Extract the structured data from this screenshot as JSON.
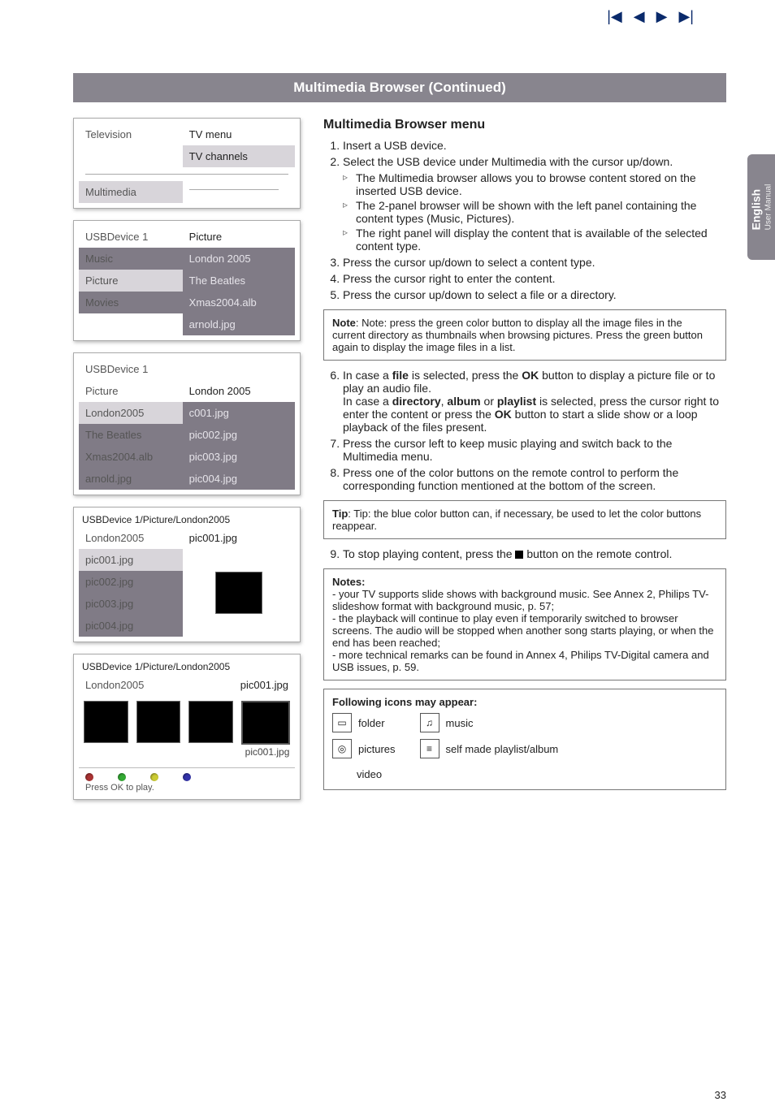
{
  "nav": {
    "first": "|◀",
    "prev": "◀",
    "next": "▶",
    "last": "▶|"
  },
  "titlebar": "Multimedia Browser  (Continued)",
  "side_tab": {
    "line1": "English",
    "line2": "User Manual"
  },
  "left": {
    "panel1": {
      "rows": [
        {
          "l": "Television",
          "r1": "TV menu",
          "r2": "TV channels"
        },
        {
          "l": "Multimedia",
          "r1": "",
          "r2": ""
        }
      ]
    },
    "panel2": {
      "rows": [
        {
          "l": "USBDevice 1",
          "r": "Picture"
        },
        {
          "l": "Music",
          "r": "London 2005"
        },
        {
          "l": "Picture",
          "r": "The Beatles"
        },
        {
          "l": "Movies",
          "r": "Xmas2004.alb"
        },
        {
          "l": "",
          "r": "arnold.jpg"
        }
      ]
    },
    "panel3": {
      "rows": [
        {
          "l": "USBDevice 1",
          "r": ""
        },
        {
          "l": "Picture",
          "r": "London 2005"
        },
        {
          "l": "London2005",
          "r": "c001.jpg"
        },
        {
          "l": "The Beatles",
          "r": "pic002.jpg"
        },
        {
          "l": "Xmas2004.alb",
          "r": "pic003.jpg"
        },
        {
          "l": "arnold.jpg",
          "r": "pic004.jpg"
        }
      ]
    },
    "panel4": {
      "title": "USBDevice 1/Picture/London2005",
      "rows": [
        {
          "l": "London2005",
          "r": "pic001.jpg"
        },
        {
          "l": "pic001.jpg",
          "r": ""
        },
        {
          "l": "pic002.jpg",
          "r": ""
        },
        {
          "l": "pic003.jpg",
          "r": ""
        },
        {
          "l": "pic004.jpg",
          "r": ""
        }
      ]
    },
    "panel5": {
      "title": "USBDevice 1/Picture/London2005",
      "headerL": "London2005",
      "headerR": "pic001.jpg",
      "thumb_caption": "pic001.jpg",
      "footer": "Press OK to play."
    }
  },
  "right": {
    "heading": "Multimedia Browser menu",
    "steps": [
      "Insert a USB device.",
      "Select the USB device under Multimedia with the cursor up/down.",
      "Press the cursor up/down to select a content type.",
      "Press the cursor right to enter the content.",
      "Press the cursor up/down to select a file or a directory."
    ],
    "sub2": [
      "The Multimedia browser allows you to browse content stored on the inserted USB device.",
      "The 2-panel browser will be shown with the left panel containing the content types (Music, Pictures).",
      "The right panel will display the content that is available of the selected content type."
    ],
    "notebox": "Note: press the green color button to display all the image files in the current directory as thumbnails when browsing pictures. Press the green button again to display the image files in a list.",
    "step6": "In case a file is selected, press the OK button to display a picture file or to play an audio file.\nIn case a directory, album or playlist is selected, press the cursor right to enter the content or press the OK button to start a slide show or a loop playback of the files present.",
    "step7": "Press the cursor left to keep music playing and switch back to the Multimedia menu.",
    "step8": "Press one of the color buttons on the remote control to perform the corresponding function mentioned at the bottom of the screen.",
    "tipbox": "Tip: the blue color button can, if necessary, be used to let the color buttons reappear.",
    "step9": "To stop playing content, press the ■ button on the remote control.",
    "notesbox_title": "Notes:",
    "notesbox_items": [
      "your TV supports slide shows with background music. See Annex 2, Philips TV-slideshow format with background music, p. 57;",
      "the playback will continue to play even if temporarily switched to browser screens. The audio will be stopped when another song starts playing, or when the end has been reached;",
      "more technical remarks can be found in Annex 4, Philips TV-Digital camera and USB issues, p. 59."
    ],
    "iconsbox_title": "Following icons may appear:",
    "icons": {
      "folder": "folder",
      "pictures": "pictures",
      "video": "video",
      "music": "music",
      "playlist": "self made playlist/album"
    }
  },
  "pagenum": "33"
}
